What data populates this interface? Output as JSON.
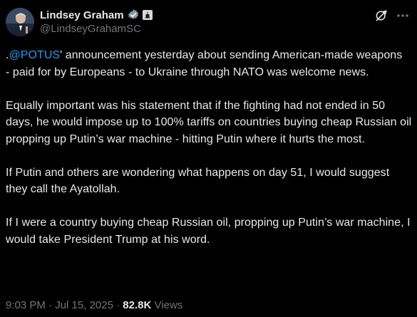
{
  "author": {
    "name": "Lindsey Graham",
    "handle": "@LindseyGrahamSC"
  },
  "icons": {
    "verified": "verified-badge-icon",
    "government": "government-badge-icon",
    "grok": "grok-icon",
    "more": "more-options-icon"
  },
  "colors": {
    "background": "#000000",
    "text": "#e7e9ea",
    "muted": "#71767b",
    "link": "#1d9bf0",
    "verified": "#1d9bf0"
  },
  "post": {
    "p1_prefix": ".",
    "p1_mention": "@POTUS",
    "p1_rest": "' announcement yesterday about sending American-made weapons  - paid for by Europeans - to Ukraine through NATO was welcome news.",
    "p2": "Equally important was his statement that if the fighting had not ended in 50 days, he would impose up to 100% tariffs on countries buying cheap Russian oil propping up Putin’s war machine - hitting Putin where it hurts the most.",
    "p3": "If Putin and others are wondering what happens on day 51, I would suggest they call the Ayatollah.",
    "p4": "If I were a country buying cheap Russian oil, propping up Putin’s war machine, I would take President Trump at his word."
  },
  "meta": {
    "time": "9:03 PM",
    "separator": " · ",
    "date": "Jul 15, 2025",
    "views_count": "82.8K",
    "views_label": " Views"
  }
}
